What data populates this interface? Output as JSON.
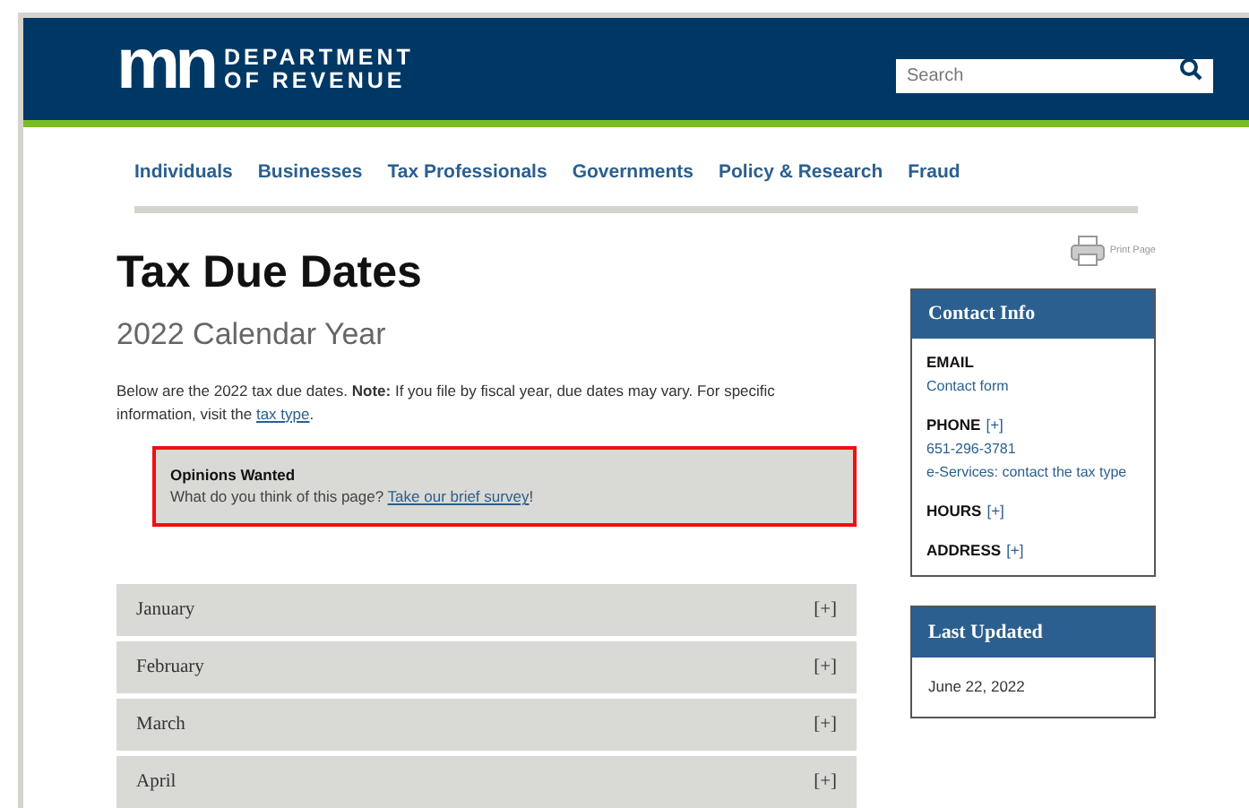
{
  "header": {
    "logo_mark": "mn",
    "logo_text": [
      "DEPARTMENT",
      "OF REVENUE"
    ],
    "search": {
      "placeholder": "Search"
    }
  },
  "nav": [
    "Individuals",
    "Businesses",
    "Tax Professionals",
    "Governments",
    "Policy & Research",
    "Fraud"
  ],
  "print": "Print Page",
  "title": "Tax Due Dates",
  "subtitle": "2022 Calendar Year",
  "intro": {
    "text": "Below are the 2022 tax due dates. **Note:** If you file by fiscal year, due dates may vary. For specific information, visit the ",
    "link": "tax type",
    "end": "."
  },
  "notice": {
    "title": "Opinions Wanted",
    "text": "What do you think of this page? ",
    "link": "Take our brief survey",
    "end": "!"
  },
  "months": [
    {
      "label": "January",
      "toggle": "[+]"
    },
    {
      "label": "February",
      "toggle": "[+]"
    },
    {
      "label": "March",
      "toggle": "[+]"
    },
    {
      "label": "April",
      "toggle": "[+]"
    }
  ],
  "contact": {
    "title": "Contact Info",
    "sections": [
      {
        "label": "EMAIL",
        "lines": [
          {
            "text": "Contact form",
            "kind": "link"
          }
        ]
      },
      {
        "label": "PHONE",
        "toggle": "[+]",
        "lines": [
          {
            "text": "651-296-3781",
            "kind": "link"
          },
          {
            "text": "e-Services: contact the tax type",
            "kind": "link"
          }
        ]
      },
      {
        "label": "HOURS",
        "toggle": "[+]"
      },
      {
        "label": "ADDRESS",
        "toggle": "[+]"
      }
    ]
  },
  "last_updated": {
    "title": "Last Updated",
    "date": "June 22, 2022"
  }
}
